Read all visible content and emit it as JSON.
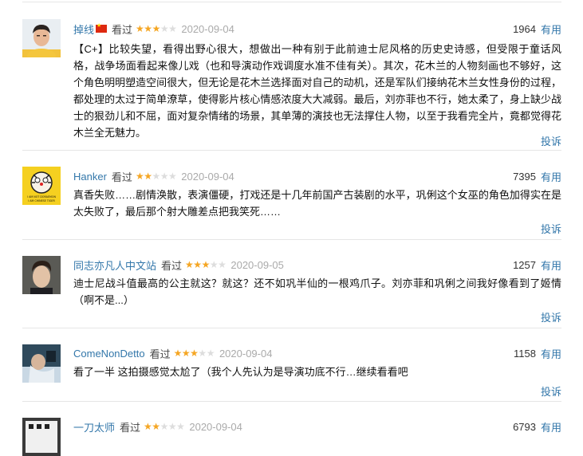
{
  "status_label": "看过",
  "useful_label": "有用",
  "report_label": "投诉",
  "reviews": [
    {
      "user": "掉线",
      "rating": 3,
      "date": "2020-09-04",
      "votes": "1964",
      "text": "【C+】比较失望，看得出野心很大，想做出一种有别于此前迪士尼风格的历史史诗感，但受限于童话风格，战争场面看起来像儿戏（也和导演动作戏调度水准不佳有关）。其次，花木兰的人物刻画也不够好，这个角色明明塑造空间很大，但无论是花木兰选择面对自己的动机，还是军队们接纳花木兰女性身份的过程，都处理的太过于简单潦草，使得影片核心情感浓度大大减弱。最后，刘亦菲也不行，她太柔了，身上缺少战士的狠劲儿和不屈，面对复杂情绪的场景，其单薄的演技也无法撑住人物，以至于我看完全片，竟都觉得花木兰全无魅力。"
    },
    {
      "user": "Hanker",
      "rating": 2,
      "date": "2020-09-04",
      "votes": "7395",
      "text": "真香失败……剧情涣散，表演僵硬，打戏还是十几年前国产古装剧的水平，巩俐这个女巫的角色加得实在是太失败了，最后那个射大雕差点把我笑死……",
      "avatar_caption": [
        "I AM NOT DORAEMON",
        "I AM CHINESE TIGER"
      ]
    },
    {
      "user": "同志亦凡人中文站",
      "rating": 3,
      "date": "2020-09-05",
      "votes": "1257",
      "text": "迪士尼战斗值最高的公主就这？就这？还不如巩半仙的一根鸡爪子。刘亦菲和巩俐之间我好像看到了姬情（啊不是...）"
    },
    {
      "user": "ComeNonDetto",
      "rating": 3,
      "date": "2020-09-04",
      "votes": "1158",
      "text": "看了一半 这拍摄感觉太尬了（我个人先认为是导演功底不行…继续看看吧"
    },
    {
      "user": "一刀太师",
      "rating": 2,
      "date": "2020-09-04",
      "votes": "6793",
      "text": ""
    }
  ]
}
